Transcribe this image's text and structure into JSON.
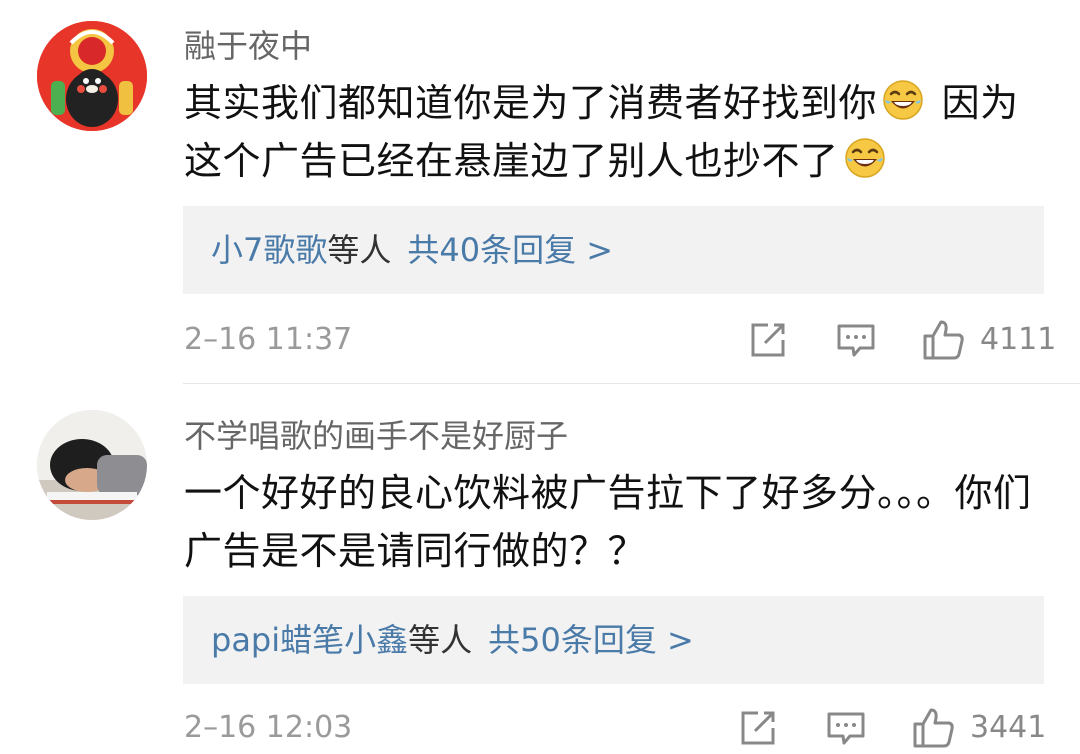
{
  "comments": [
    {
      "username": "融于夜中",
      "avatar_icon": "kumamon-lion-dance-avatar",
      "text_part1": "其实我们都知道你是为了消费者好找到你",
      "emoji_icon": "laughing-tears-emoji",
      "text_part2": " 因为这个广告已经在悬崖边了别人也抄不了",
      "reply_users": "小7歌歌",
      "reply_mid": "等人",
      "reply_count": "共40条回复 >",
      "timestamp": "2–16 11:37",
      "likes": "4111"
    },
    {
      "username": "不学唱歌的画手不是好厨子",
      "avatar_icon": "sleeping-child-avatar",
      "text": "一个好好的良心饮料被广告拉下了好多分。。。你们广告是不是请同行做的？？",
      "reply_users": "papi蜡笔小鑫",
      "reply_mid": "等人",
      "reply_count": "共50条回复 >",
      "timestamp": "2–16 12:03",
      "likes": "3441"
    }
  ],
  "colors": {
    "link_blue": "#4a7aa8",
    "reply_bg": "#f2f2f2",
    "meta_gray": "#9a9a9a",
    "username_gray": "#666666"
  }
}
